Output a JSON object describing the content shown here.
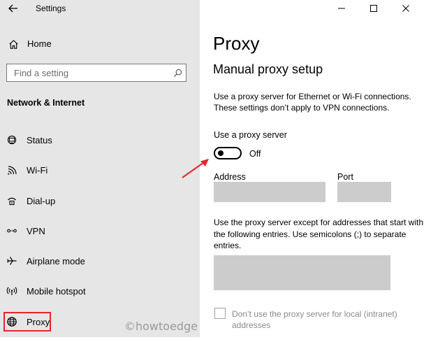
{
  "window": {
    "title": "Settings",
    "back_icon": "back-arrow-icon",
    "controls": [
      "minimize-icon",
      "maximize-icon",
      "close-icon"
    ]
  },
  "sidebar": {
    "home": {
      "label": "Home",
      "icon": "home-icon"
    },
    "search": {
      "placeholder": "Find a setting",
      "icon": "search-icon"
    },
    "section_title": "Network & Internet",
    "items": [
      {
        "label": "Status",
        "icon": "status-icon"
      },
      {
        "label": "Wi-Fi",
        "icon": "wifi-icon"
      },
      {
        "label": "Dial-up",
        "icon": "dialup-icon"
      },
      {
        "label": "VPN",
        "icon": "vpn-icon"
      },
      {
        "label": "Airplane mode",
        "icon": "airplane-icon"
      },
      {
        "label": "Mobile hotspot",
        "icon": "hotspot-icon"
      },
      {
        "label": "Proxy",
        "icon": "globe-icon",
        "selected": true
      }
    ]
  },
  "main": {
    "page_title": "Proxy",
    "section_title": "Manual proxy setup",
    "description_lines": [
      "Use a proxy server for Ethernet or Wi-Fi connections.",
      "These settings don’t apply to VPN connections."
    ],
    "use_proxy": {
      "label": "Use a proxy server",
      "state_label": "Off",
      "on": false
    },
    "address": {
      "label": "Address",
      "value": ""
    },
    "port": {
      "label": "Port",
      "value": ""
    },
    "exceptions": {
      "description_lines": [
        "Use the proxy server except for addresses that start with",
        "the following entries. Use semicolons (;) to separate",
        "entries."
      ],
      "value": ""
    },
    "local_checkbox": {
      "label_lines": [
        "Don’t use the proxy server for local (intranet)",
        "addresses"
      ],
      "checked": false
    }
  },
  "annotations": {
    "highlight_color": "#e4262b",
    "watermark": "©howtoedge"
  }
}
